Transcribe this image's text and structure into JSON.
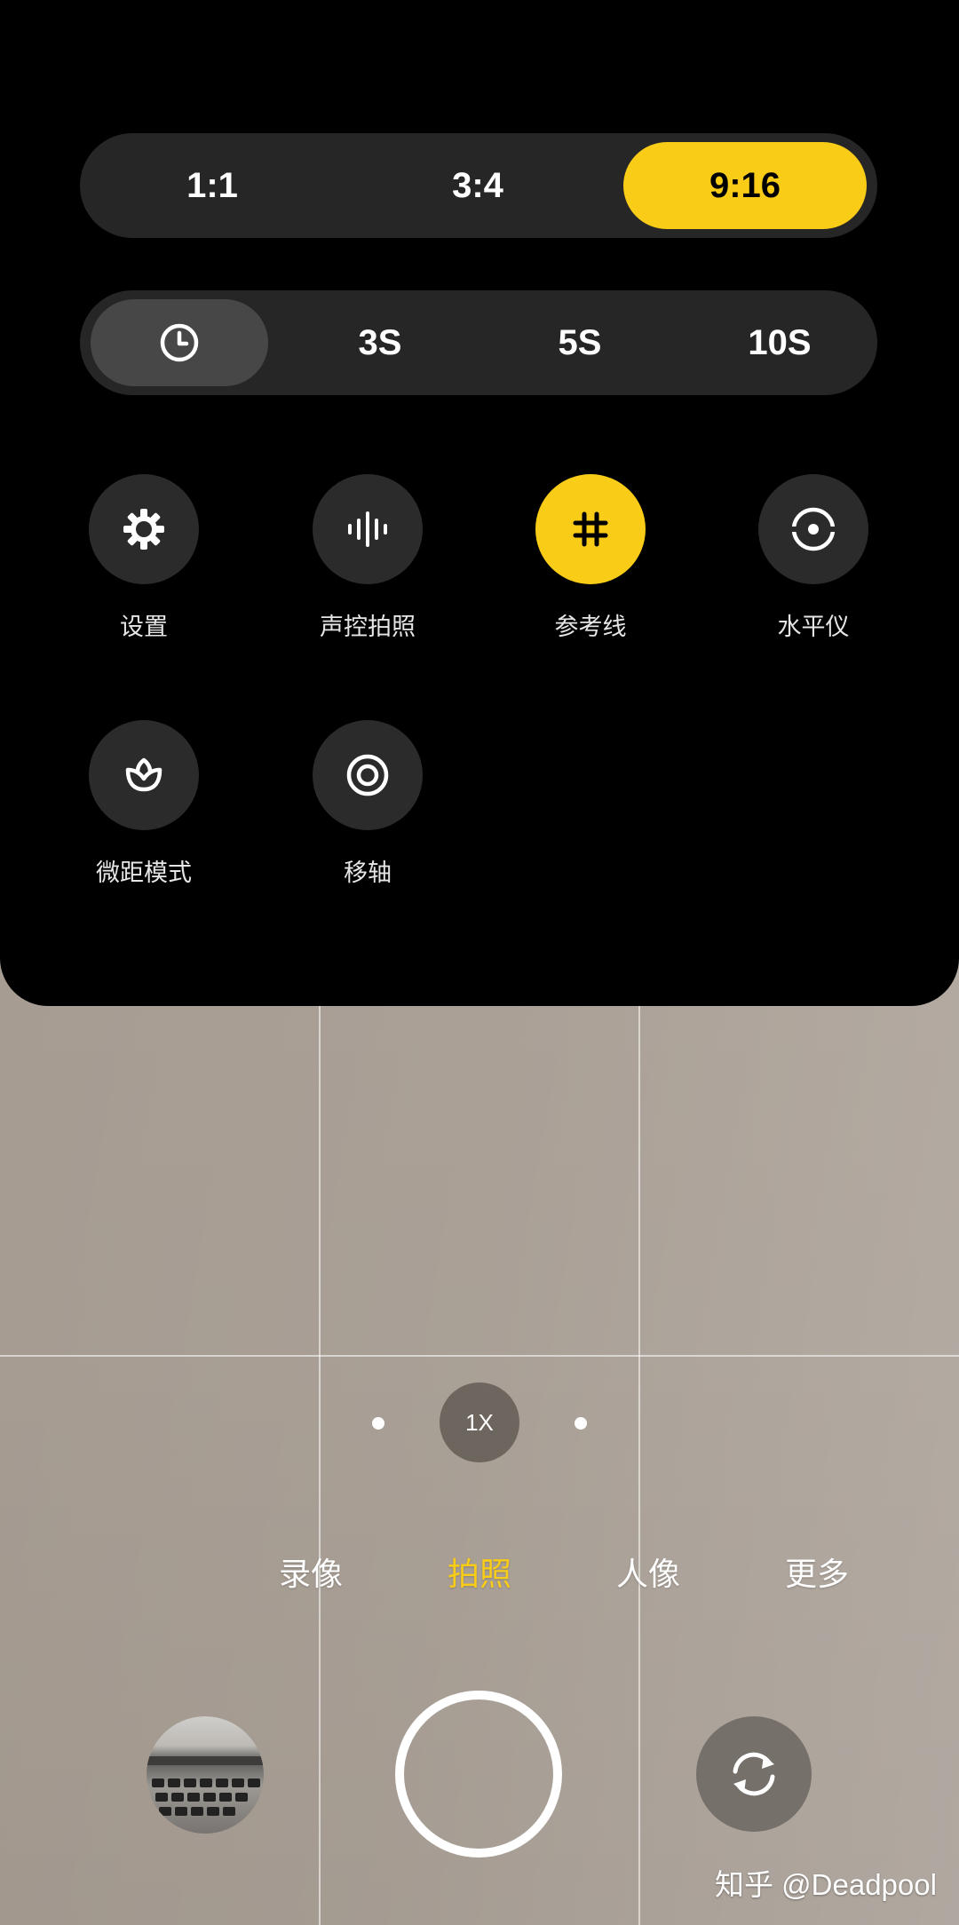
{
  "aspect_ratio": {
    "options": [
      "1:1",
      "3:4",
      "9:16"
    ],
    "selected": "9:16"
  },
  "timer": {
    "icon": "clock-icon",
    "options": [
      "3S",
      "5S",
      "10S"
    ]
  },
  "tools": [
    {
      "label": "设置",
      "icon": "gear-icon"
    },
    {
      "label": "声控拍照",
      "icon": "soundwave-icon"
    },
    {
      "label": "参考线",
      "icon": "grid-icon",
      "active": true
    },
    {
      "label": "水平仪",
      "icon": "level-icon"
    },
    {
      "label": "微距模式",
      "icon": "flower-icon"
    },
    {
      "label": "移轴",
      "icon": "tilt-shift-icon"
    }
  ],
  "zoom": {
    "label": "1X"
  },
  "modes": [
    "录像",
    "拍照",
    "人像",
    "更多"
  ],
  "active_mode": "拍照",
  "watermark": "知乎 @Deadpool",
  "colors": {
    "accent": "#f9cc17",
    "panel": "#000000",
    "control": "#2b2b2b"
  }
}
